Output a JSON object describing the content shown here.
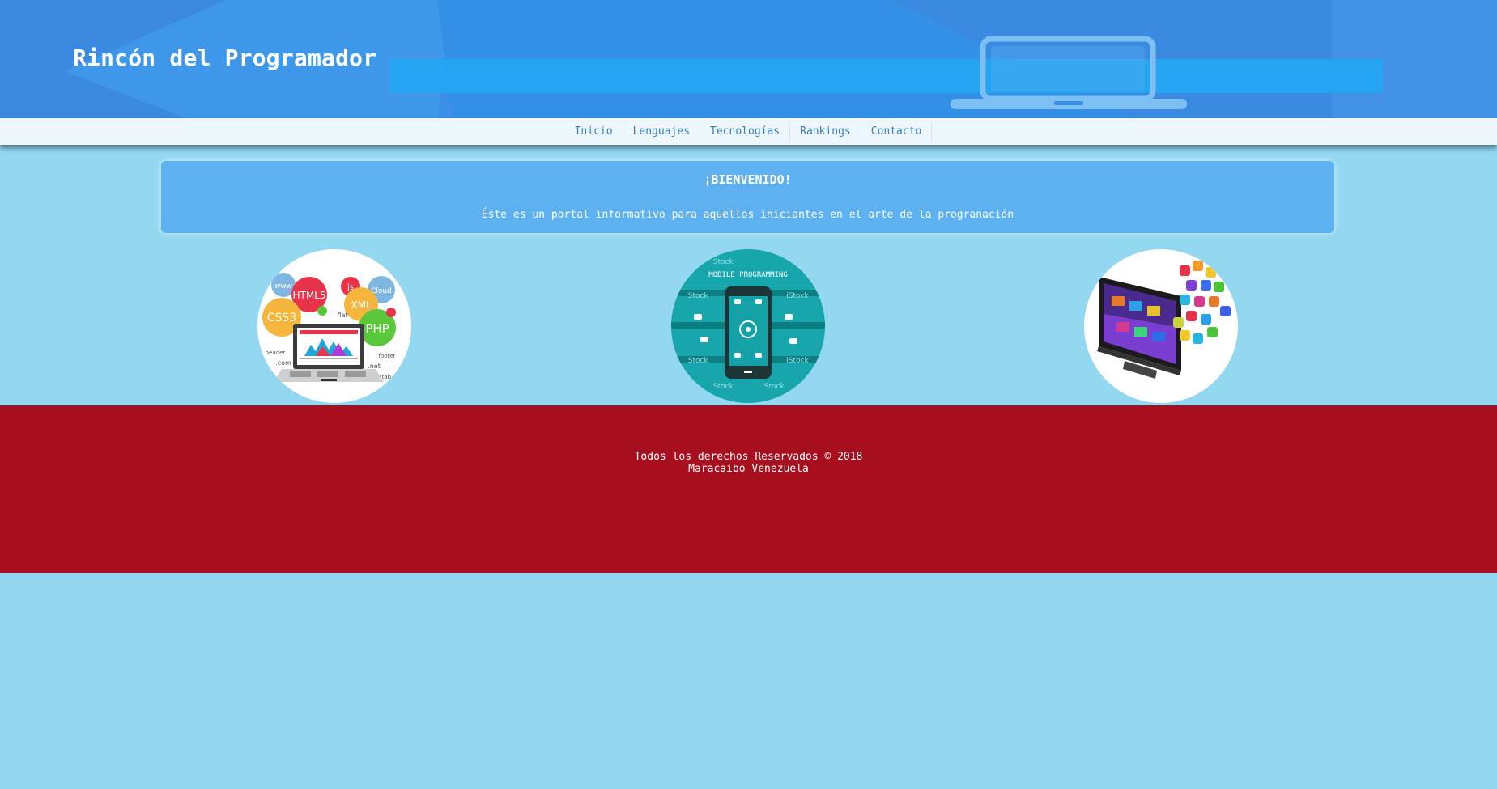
{
  "site": {
    "brand": "Rincón del Programador"
  },
  "nav": {
    "items": [
      {
        "label": "Inicio"
      },
      {
        "label": "Lenguajes"
      },
      {
        "label": "Tecnologías"
      },
      {
        "label": "Rankings"
      },
      {
        "label": "Contacto"
      }
    ]
  },
  "welcome": {
    "title": "¡BIENVENIDO!",
    "text": "Éste es un portal informativo para aquellos iniciantes en el arte de la progranación"
  },
  "gallery": {
    "web_tags": [
      "www",
      "HTML5",
      "js",
      "Cloud",
      "CSS3",
      "XML",
      "PHP",
      "flat",
      "header",
      ".com",
      "footer",
      ".net",
      "datab"
    ],
    "mobile_heading": "MOBILE PROGRAMMING",
    "mobile_watermark": "iStock"
  },
  "footer": {
    "rights": "Todos los derechos Reservados © 2018",
    "location": "Maracaibo Venezuela"
  },
  "colors": {
    "background": "#93d7f1",
    "banner": "#3a8fe8",
    "panel": "#5db1f0",
    "footer": "#a80f1e",
    "nav_text": "#3a7bbf"
  }
}
